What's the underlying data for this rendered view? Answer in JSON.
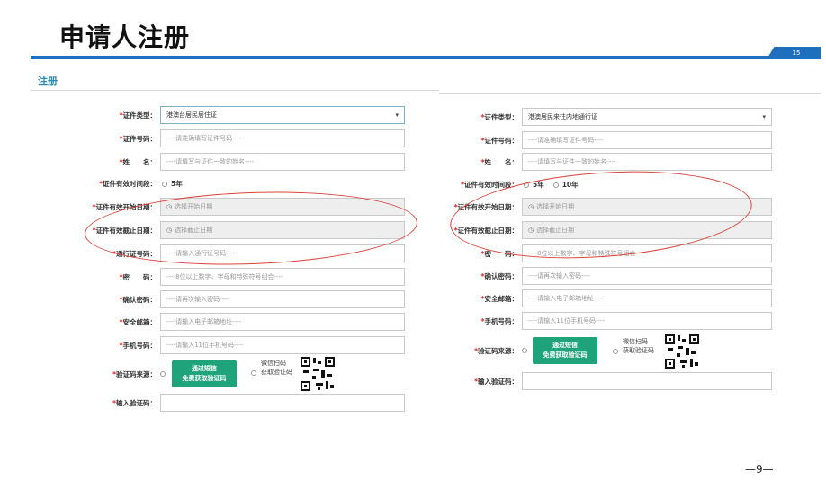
{
  "header": {
    "title": "申请人注册",
    "badge": "15"
  },
  "section": {
    "title": "注册"
  },
  "left_form": {
    "id_type": {
      "label": "证件类型：",
      "value": "港澳台居民居住证"
    },
    "id_number": {
      "label": "证件号码：",
      "placeholder": "----请准确填写证件号码----"
    },
    "name": {
      "label": "姓　　名：",
      "placeholder": "----请填写与证件一致的姓名----"
    },
    "validity": {
      "label": "证件有效时间段：",
      "option": "5年"
    },
    "start_date": {
      "label": "证件有效开始日期：",
      "placeholder": "选择开始日期"
    },
    "end_date": {
      "label": "证件有效截止日期：",
      "placeholder": "选择截止日期"
    },
    "pass_number": {
      "label": "通行证号码：",
      "placeholder": "----请输入通行证号码----"
    },
    "password": {
      "label": "密　　码：",
      "placeholder": "----8位以上数字、字母和特殊符号组合----"
    },
    "confirm_password": {
      "label": "确认密码：",
      "placeholder": "----请再次输入密码----"
    },
    "email": {
      "label": "安全邮箱：",
      "placeholder": "----请输入电子邮箱地址----"
    },
    "phone": {
      "label": "手机号码：",
      "placeholder": "----请输入11位手机号码----"
    },
    "code_source": {
      "label": "验证码来源：",
      "sms_line1": "通过短信",
      "sms_line2": "免费获取验证码",
      "wechat_line1": "微信扫码",
      "wechat_line2": "获取验证码"
    },
    "code_input": {
      "label": "输入验证码：",
      "placeholder": ""
    }
  },
  "right_form": {
    "id_type": {
      "label": "证件类型：",
      "value": "港澳居民来往内地通行证"
    },
    "id_number": {
      "label": "证件号码：",
      "placeholder": "----请准确填写证件号码----"
    },
    "name": {
      "label": "姓　　名：",
      "placeholder": "----请填写与证件一致的姓名----"
    },
    "validity": {
      "label": "证件有效时间段：",
      "option1": "5年",
      "option2": "10年"
    },
    "start_date": {
      "label": "证件有效开始日期：",
      "placeholder": "选择开始日期"
    },
    "end_date": {
      "label": "证件有效截止日期：",
      "placeholder": "选择截止日期"
    },
    "password": {
      "label": "密　　码：",
      "placeholder": "----8位以上数字、字母和特殊符号组合----"
    },
    "confirm_password": {
      "label": "确认密码：",
      "placeholder": "----请再次输入密码----"
    },
    "email": {
      "label": "安全邮箱：",
      "placeholder": "----请输入电子邮箱地址----"
    },
    "phone": {
      "label": "手机号码：",
      "placeholder": "----请输入11位手机号码----"
    },
    "code_source": {
      "label": "验证码来源：",
      "sms_line1": "通过短信",
      "sms_line2": "免费获取验证码",
      "wechat_line1": "微信扫码",
      "wechat_line2": "获取验证码"
    },
    "code_input": {
      "label": "输入验证码：",
      "placeholder": ""
    }
  },
  "footer": {
    "page": "—9—"
  },
  "colors": {
    "accent": "#1f6fbf",
    "section_title": "#2a8ab2",
    "button": "#1fa37a",
    "required": "#e02020",
    "highlight": "#d9433a"
  }
}
